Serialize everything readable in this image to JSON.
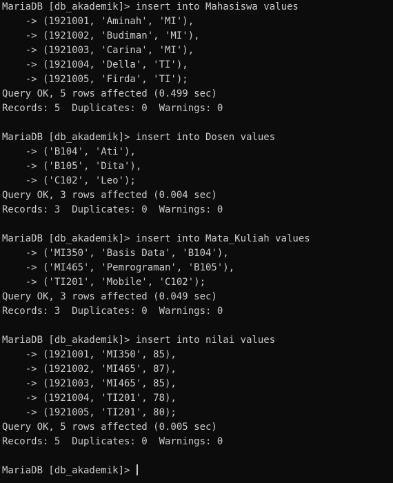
{
  "terminal": {
    "lines": [
      "MariaDB [db_akademik]> insert into Mahasiswa values",
      "    -> (1921001, 'Aminah', 'MI'),",
      "    -> (1921002, 'Budiman', 'MI'),",
      "    -> (1921003, 'Carina', 'MI'),",
      "    -> (1921004, 'Della', 'TI'),",
      "    -> (1921005, 'Firda', 'TI');",
      "Query OK, 5 rows affected (0.499 sec)",
      "Records: 5  Duplicates: 0  Warnings: 0",
      "",
      "MariaDB [db_akademik]> insert into Dosen values",
      "    -> ('B104', 'Ati'),",
      "    -> ('B105', 'Dita'),",
      "    -> ('C102', 'Leo');",
      "Query OK, 3 rows affected (0.004 sec)",
      "Records: 3  Duplicates: 0  Warnings: 0",
      "",
      "MariaDB [db_akademik]> insert into Mata_Kuliah values",
      "    -> ('MI350', 'Basis Data', 'B104'),",
      "    -> ('MI465', 'Pemrograman', 'B105'),",
      "    -> ('TI201', 'Mobile', 'C102');",
      "Query OK, 3 rows affected (0.049 sec)",
      "Records: 3  Duplicates: 0  Warnings: 0",
      "",
      "MariaDB [db_akademik]> insert into nilai values",
      "    -> (1921001, 'MI350', 85),",
      "    -> (1921002, 'MI465', 87),",
      "    -> (1921003, 'MI465', 85),",
      "    -> (1921004, 'TI201', 78),",
      "    -> (1921005, 'TI201', 80);",
      "Query OK, 5 rows affected (0.005 sec)",
      "Records: 5  Duplicates: 0  Warnings: 0",
      ""
    ],
    "prompt": "MariaDB [db_akademik]> ",
    "text_color": "#cccccc",
    "background_color": "#0c0c0c"
  }
}
